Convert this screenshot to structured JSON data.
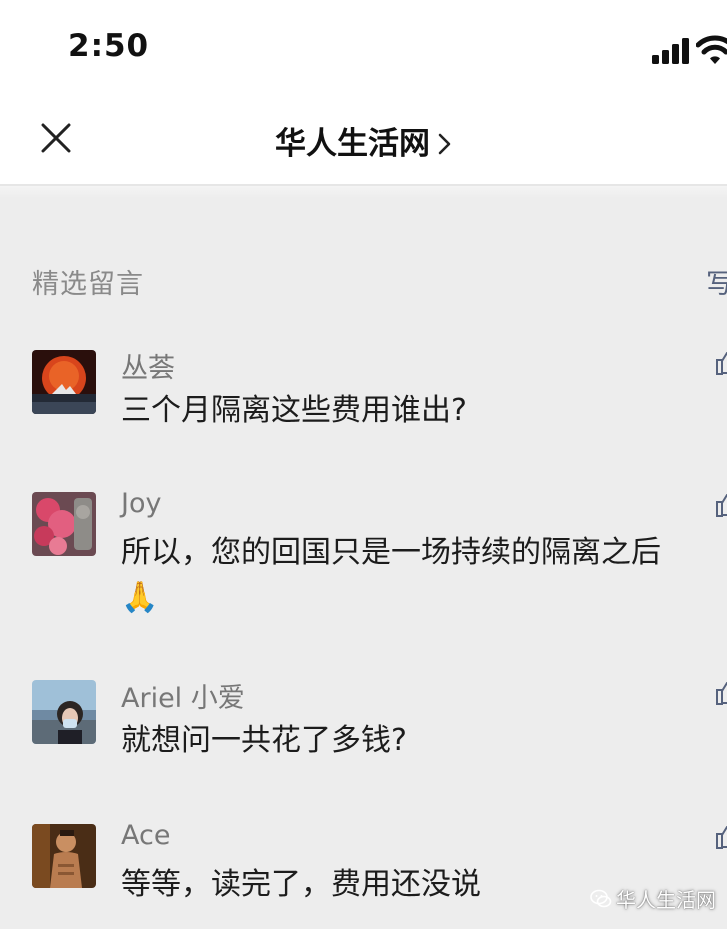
{
  "status_bar": {
    "time": "2:50"
  },
  "nav": {
    "title": "华人生活网",
    "close_icon": "close-icon",
    "chevron_icon": "chevron-right-icon"
  },
  "section": {
    "title": "精选留言",
    "write_label": "写"
  },
  "comments": [
    {
      "nickname": "丛荟",
      "text": "三个月隔离这些费用谁出?",
      "avatar": "sunset-avatar"
    },
    {
      "nickname": "Joy",
      "text": "所以，您的回国只是一场持续的隔离之后",
      "emoji": "🙏",
      "avatar": "flowers-avatar"
    },
    {
      "nickname": "Ariel 小爱",
      "text": "就想问一共花了多钱?",
      "avatar": "masked-person-avatar"
    },
    {
      "nickname": "Ace",
      "text": "等等，读完了，费用还没说",
      "avatar": "man-avatar"
    }
  ],
  "watermark": {
    "text": "华人生活网"
  },
  "colors": {
    "background": "#ededed",
    "header_background": "#ffffff",
    "link_color": "#56627d",
    "nickname_color": "#777777"
  }
}
